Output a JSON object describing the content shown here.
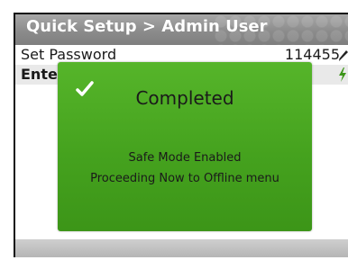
{
  "header": {
    "title": "Quick Setup > Admin User"
  },
  "rows": [
    {
      "label": "Set Password",
      "value": "114455",
      "icon": "pencil-icon"
    },
    {
      "label": "Ente",
      "value": "",
      "icon": "lightning-bolt-icon"
    }
  ],
  "dialog": {
    "icon": "checkmark-icon",
    "title": "Completed",
    "message_line1": "Safe Mode Enabled",
    "message_line2": "Proceeding Now to Offline menu",
    "color": "#4caf26"
  },
  "colors": {
    "header_bg": "#8f8f8f",
    "highlight_row": "#e9e9e9",
    "dialog_green": "#4caf26"
  }
}
